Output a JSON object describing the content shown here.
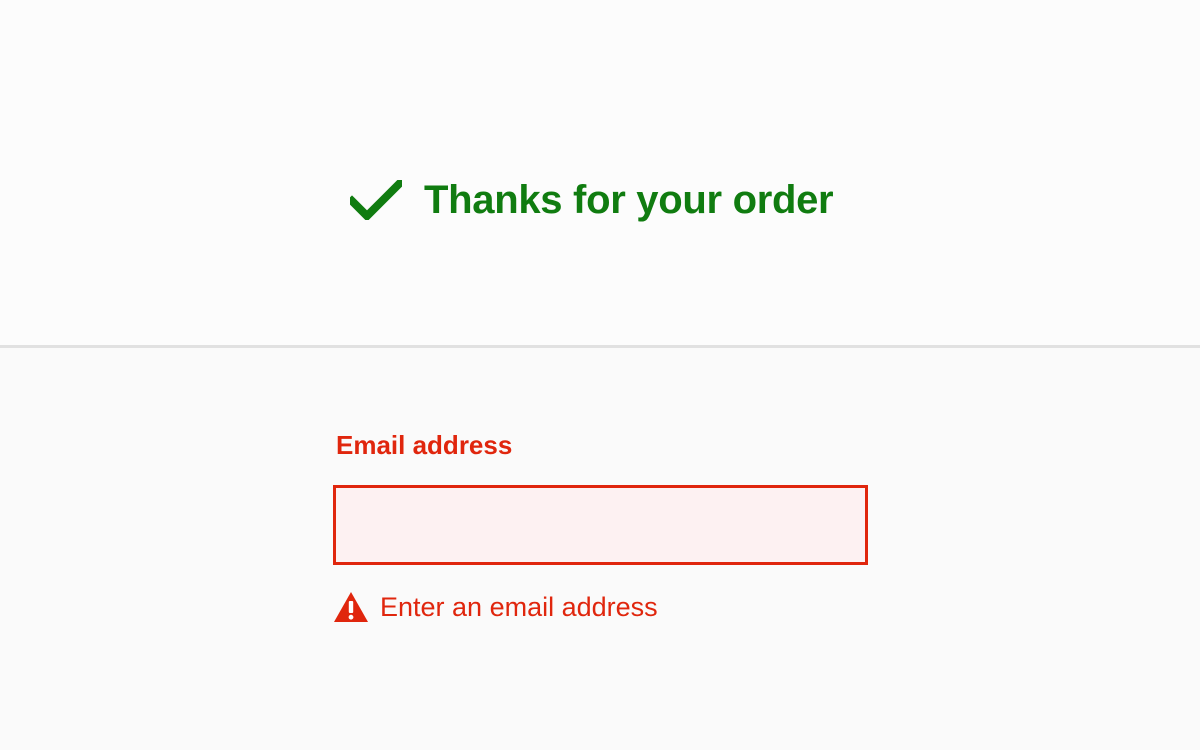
{
  "success": {
    "message": "Thanks for your order",
    "icon": "checkmark-icon",
    "color": "#107c10"
  },
  "form": {
    "email": {
      "label": "Email address",
      "value": "",
      "placeholder": "",
      "error": "Enter an email address",
      "error_icon": "warning-icon",
      "error_color": "#e0260d",
      "input_background": "#fdf1f2"
    }
  }
}
